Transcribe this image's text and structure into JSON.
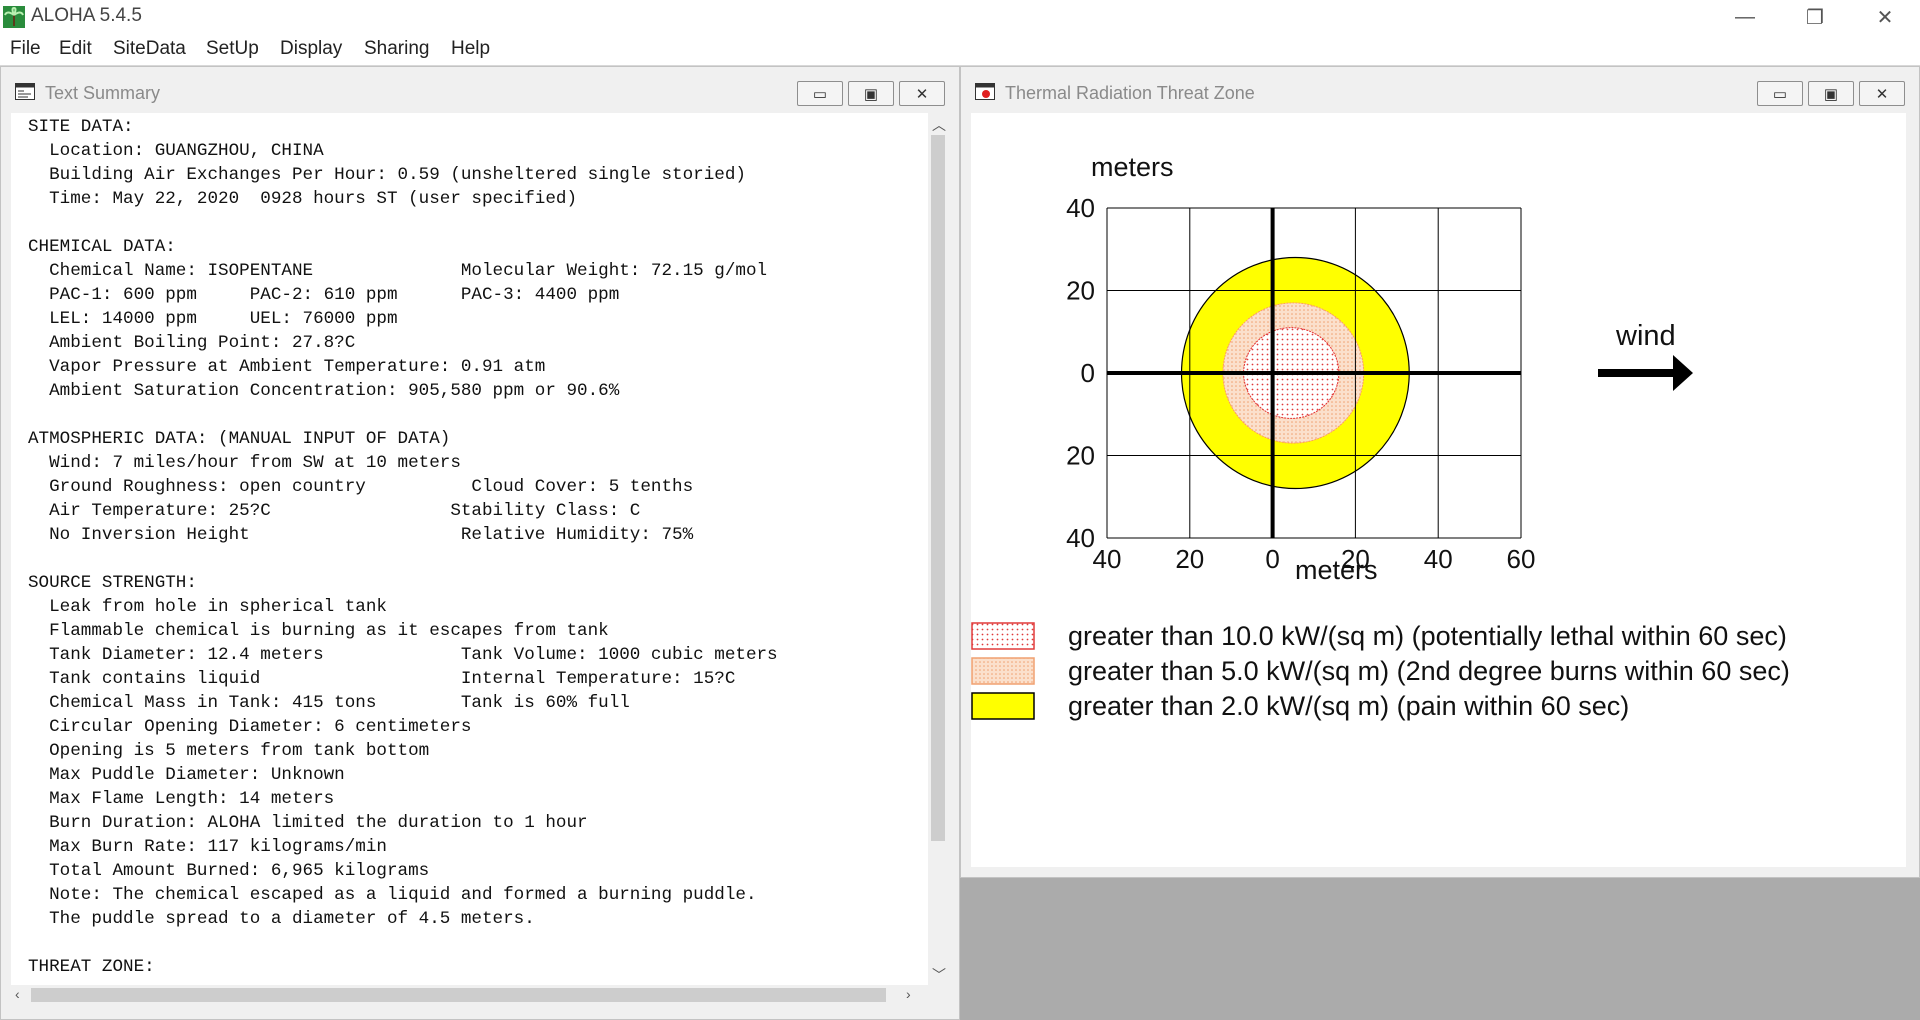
{
  "app": {
    "title": "ALOHA 5.4.5"
  },
  "menu": [
    "File",
    "Edit",
    "SiteData",
    "SetUp",
    "Display",
    "Sharing",
    "Help"
  ],
  "window_controls": {
    "minimize": "—",
    "restore": "❐",
    "close": "✕"
  },
  "text_summary": {
    "title": "Text Summary",
    "lines": [
      "SITE DATA:",
      "  Location: GUANGZHOU, CHINA",
      "  Building Air Exchanges Per Hour: 0.59 (unsheltered single storied)",
      "  Time: May 22, 2020  0928 hours ST (user specified)",
      "",
      "CHEMICAL DATA:",
      "  Chemical Name: ISOPENTANE              Molecular Weight: 72.15 g/mol",
      "  PAC-1: 600 ppm     PAC-2: 610 ppm      PAC-3: 4400 ppm",
      "  LEL: 14000 ppm     UEL: 76000 ppm",
      "  Ambient Boiling Point: 27.8?C",
      "  Vapor Pressure at Ambient Temperature: 0.91 atm",
      "  Ambient Saturation Concentration: 905,580 ppm or 90.6%",
      "",
      "ATMOSPHERIC DATA: (MANUAL INPUT OF DATA)",
      "  Wind: 7 miles/hour from SW at 10 meters",
      "  Ground Roughness: open country          Cloud Cover: 5 tenths",
      "  Air Temperature: 25?C                 Stability Class: C",
      "  No Inversion Height                    Relative Humidity: 75%",
      "",
      "SOURCE STRENGTH:",
      "  Leak from hole in spherical tank",
      "  Flammable chemical is burning as it escapes from tank",
      "  Tank Diameter: 12.4 meters             Tank Volume: 1000 cubic meters",
      "  Tank contains liquid                   Internal Temperature: 15?C",
      "  Chemical Mass in Tank: 415 tons        Tank is 60% full",
      "  Circular Opening Diameter: 6 centimeters",
      "  Opening is 5 meters from tank bottom",
      "  Max Puddle Diameter: Unknown",
      "  Max Flame Length: 14 meters",
      "  Burn Duration: ALOHA limited the duration to 1 hour",
      "  Max Burn Rate: 117 kilograms/min",
      "  Total Amount Burned: 6,965 kilograms",
      "  Note: The chemical escaped as a liquid and formed a burning puddle.",
      "  The puddle spread to a diameter of 4.5 meters.",
      "",
      "THREAT ZONE:"
    ]
  },
  "threat_window": {
    "title": "Thermal Radiation Threat Zone",
    "wind_label": "wind"
  },
  "chart_data": {
    "type": "threat-zone",
    "ylabel": "meters",
    "xlabel": "meters",
    "xlim": [
      -40,
      60
    ],
    "ylim": [
      -40,
      40
    ],
    "x_ticks": [
      "40",
      "20",
      "0",
      "20",
      "40",
      "60"
    ],
    "y_ticks": [
      "40",
      "20",
      "0",
      "20",
      "40"
    ],
    "grid": true,
    "zones": [
      {
        "label": "greater than 2.0 kW/(sq m) (pain within 60 sec)",
        "color": "#ffff00",
        "edge": "#000000",
        "x_min": -22,
        "x_max": 33,
        "y_max": 28
      },
      {
        "label": "greater than 5.0 kW/(sq m) (2nd degree burns within 60 sec)",
        "color": "#fcd9c2",
        "edge": "#ff9966",
        "x_min": -12,
        "x_max": 22,
        "y_max": 17
      },
      {
        "label": "greater than 10.0 kW/(sq m) (potentially lethal within 60 sec)",
        "color": "#fbe3e3",
        "edge": "#e33030",
        "x_min": -7,
        "x_max": 16,
        "y_max": 11
      }
    ],
    "legend": [
      "greater than 10.0 kW/(sq m) (potentially lethal within 60 sec)",
      "greater than 5.0 kW/(sq m) (2nd degree burns within 60 sec)",
      "greater than 2.0 kW/(sq m) (pain within 60 sec)"
    ]
  }
}
